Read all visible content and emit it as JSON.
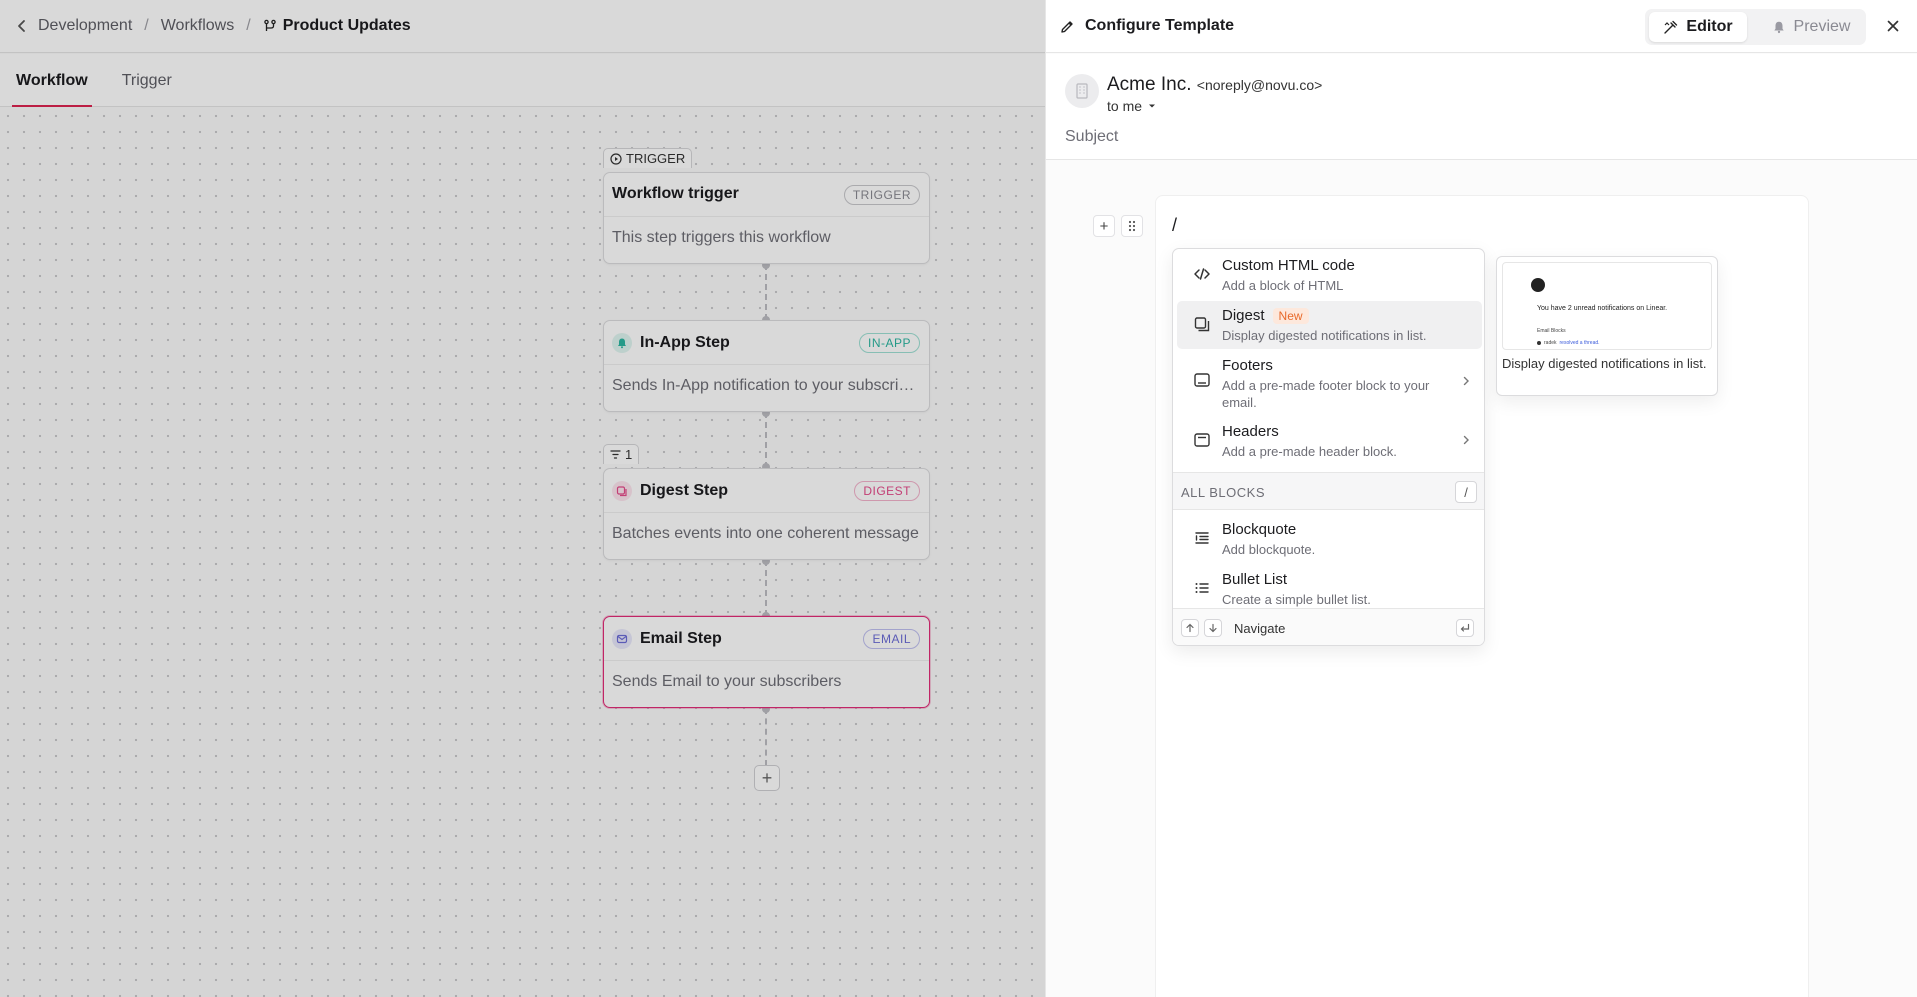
{
  "breadcrumb": {
    "items": [
      "Development",
      "Workflows"
    ],
    "current": "Product Updates"
  },
  "tabs": [
    "Workflow",
    "Trigger"
  ],
  "workflow": {
    "trigger_tag": "TRIGGER",
    "filter_tag": "1",
    "steps": [
      {
        "title": "Workflow trigger",
        "badge": "TRIGGER",
        "desc": "This step triggers this workflow",
        "icon": "none"
      },
      {
        "title": "In-App Step",
        "badge": "IN-APP",
        "desc": "Sends In-App notification to your subscribers",
        "icon": "bell-icon",
        "color": "#2bb5a0"
      },
      {
        "title": "Digest Step",
        "badge": "DIGEST",
        "desc": "Batches events into one coherent message",
        "icon": "digest-icon",
        "color": "#e54b8a"
      },
      {
        "title": "Email Step",
        "badge": "EMAIL",
        "desc": "Sends Email to your subscribers",
        "icon": "email-icon",
        "color": "#6b6bd6"
      }
    ],
    "add_symbol": "+"
  },
  "panel": {
    "title": "Configure Template",
    "editor_label": "Editor",
    "preview_label": "Preview"
  },
  "email": {
    "sender_name": "Acme Inc.",
    "sender_email": "<noreply@novu.co>",
    "to": "to me",
    "subject_placeholder": "Subject",
    "slash": "/"
  },
  "menu": {
    "items": [
      {
        "label": "Custom HTML code",
        "desc": "Add a block of HTML",
        "icon": "code-icon"
      },
      {
        "label": "Digest",
        "badge": "New",
        "desc": "Display digested notifications in list.",
        "icon": "digest-block-icon"
      },
      {
        "label": "Footers",
        "desc": "Add a pre-made footer block to your email.",
        "icon": "footer-icon"
      },
      {
        "label": "Headers",
        "desc": "Add a pre-made header block.",
        "icon": "header-icon"
      }
    ],
    "section": "ALL BLOCKS",
    "section_key": "/",
    "blocks": [
      {
        "label": "Blockquote",
        "desc": "Add blockquote.",
        "icon": "blockquote-icon"
      },
      {
        "label": "Bullet List",
        "desc": "Create a simple bullet list.",
        "icon": "bullet-list-icon"
      }
    ],
    "footer_label": "Navigate"
  },
  "preview_card": {
    "title": "You have 2 unread notifications on Linear.",
    "section": "Email Blocks",
    "row_user": "radek",
    "row_action": "resolved a thread.",
    "caption": "Display digested notifications in list."
  }
}
